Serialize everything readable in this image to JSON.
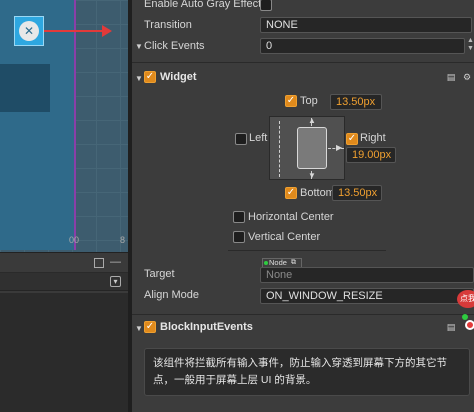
{
  "scene": {
    "ruler_labels": [
      "00",
      "8"
    ]
  },
  "inspector": {
    "enable_auto_gray_effect": {
      "label": "Enable Auto Gray Effect",
      "checked": false
    },
    "transition": {
      "label": "Transition",
      "value": "NONE"
    },
    "click_events": {
      "label": "Click Events",
      "value": "0"
    },
    "widget": {
      "title": "Widget",
      "enabled": true,
      "top": {
        "label": "Top",
        "checked": true,
        "value": "13.50px"
      },
      "left": {
        "label": "Left",
        "checked": false
      },
      "right": {
        "label": "Right",
        "checked": true,
        "value": "19.00px"
      },
      "bottom": {
        "label": "Bottom",
        "checked": true,
        "value": "13.50px"
      },
      "horizontal_center": {
        "label": "Horizontal Center",
        "checked": false
      },
      "vertical_center": {
        "label": "Vertical Center",
        "checked": false
      },
      "target": {
        "label": "Target",
        "chip": "Node",
        "value": "None"
      },
      "align_mode": {
        "label": "Align Mode",
        "value": "ON_WINDOW_RESIZE"
      }
    },
    "block_input_events": {
      "title": "BlockInputEvents",
      "enabled": true,
      "description": "该组件将拦截所有输入事件，防止输入穿透到屏幕下方的其它节点，一般用于屏幕上层 UI 的背景。"
    },
    "badge_text": "点我"
  },
  "colors": {
    "accent": "#e08a1c",
    "value_orange": "#f0a030",
    "panel_bg": "#3c3c3c",
    "field_bg": "#262626"
  }
}
